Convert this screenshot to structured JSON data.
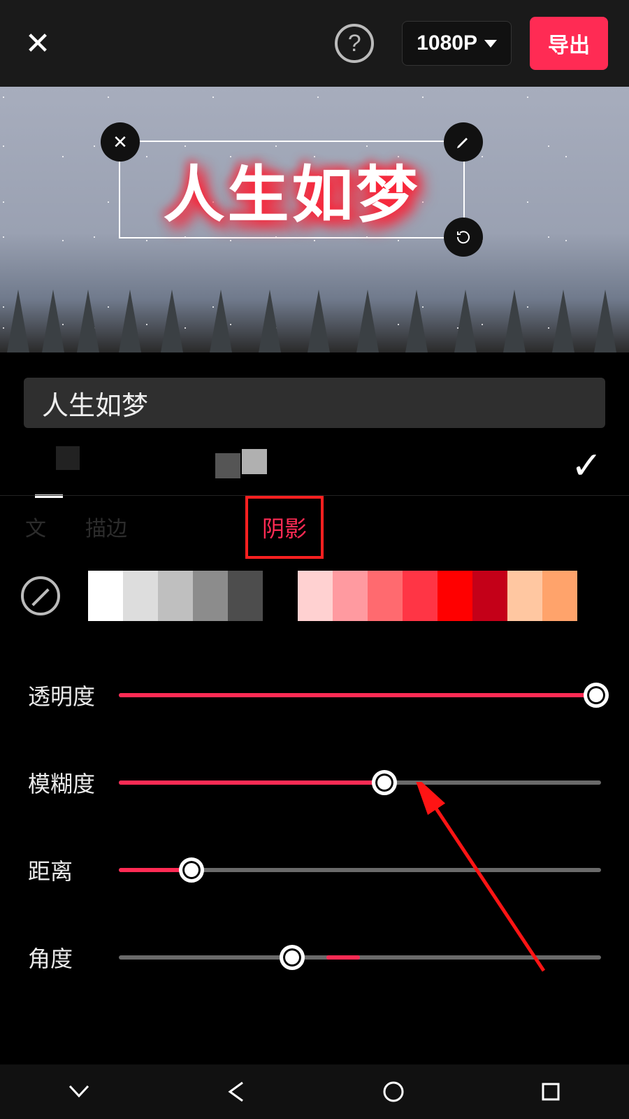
{
  "header": {
    "resolution_label": "1080P",
    "export_label": "导出"
  },
  "canvas": {
    "overlay_text": "人生如梦"
  },
  "input": {
    "value": "人生如梦"
  },
  "tabs": {
    "t0": "文",
    "t1": "描边",
    "shadow_label": "阴影"
  },
  "color_swatches": [
    "#ffffff",
    "#dddddd",
    "#bfbfbf",
    "#8c8c8c",
    "#4d4d4d",
    "#000000",
    "#ffd1d1",
    "#ff9aa0",
    "#ff6a6f",
    "#ff3545",
    "#ff0000",
    "#c40018",
    "#ffc7a1",
    "#ffa36b"
  ],
  "sliders": {
    "opacity": {
      "label": "透明度",
      "percent": 99
    },
    "blur": {
      "label": "模糊度",
      "percent": 55
    },
    "distance": {
      "label": "距离",
      "percent": 15
    },
    "angle": {
      "label": "角度",
      "percent": 36,
      "center": 50,
      "fill_to": 43
    }
  }
}
